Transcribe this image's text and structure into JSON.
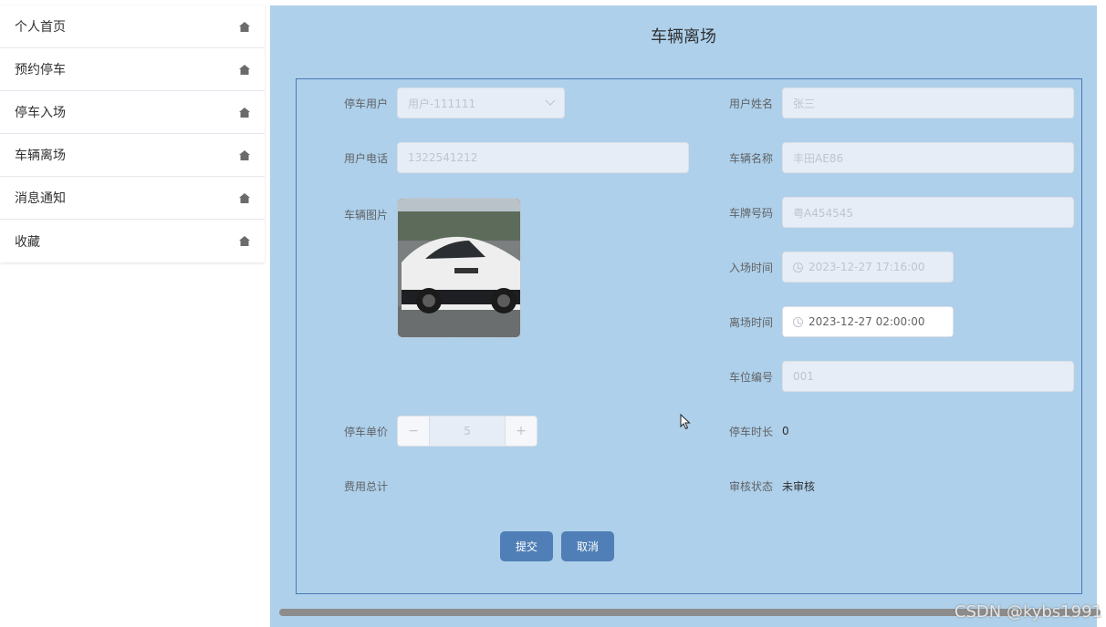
{
  "sidebar": {
    "items": [
      {
        "label": "个人首页",
        "icon": "home-icon"
      },
      {
        "label": "预约停车",
        "icon": "home-icon"
      },
      {
        "label": "停车入场",
        "icon": "home-icon"
      },
      {
        "label": "车辆离场",
        "icon": "home-icon"
      },
      {
        "label": "消息通知",
        "icon": "home-icon"
      },
      {
        "label": "收藏",
        "icon": "home-icon"
      }
    ]
  },
  "page": {
    "title": "车辆离场"
  },
  "form": {
    "user": {
      "label": "停车用户",
      "value": "用户-111111"
    },
    "user_name": {
      "label": "用户姓名",
      "value": "张三"
    },
    "phone": {
      "label": "用户电话",
      "value": "1322541212"
    },
    "car_name": {
      "label": "车辆名称",
      "value": "丰田AE86"
    },
    "car_image": {
      "label": "车辆图片"
    },
    "plate": {
      "label": "车牌号码",
      "value": "粤A454545"
    },
    "entry_time": {
      "label": "入场时间",
      "value": "2023-12-27 17:16:00"
    },
    "exit_time": {
      "label": "离场时间",
      "value": "2023-12-27 02:00:00"
    },
    "space_no": {
      "label": "车位编号",
      "value": "001"
    },
    "unit_price": {
      "label": "停车单价",
      "value": "5",
      "minus": "−",
      "plus": "+"
    },
    "duration": {
      "label": "停车时长",
      "value": "0"
    },
    "total_cost": {
      "label": "费用总计"
    },
    "review_status": {
      "label": "审核状态",
      "value": "未审核"
    }
  },
  "buttons": {
    "submit": "提交",
    "cancel": "取消"
  },
  "watermark": "CSDN @kybs1991",
  "colors": {
    "panel_bg": "#aed0ea",
    "button_bg": "#4f7fb6",
    "form_border": "#4a78b8"
  }
}
